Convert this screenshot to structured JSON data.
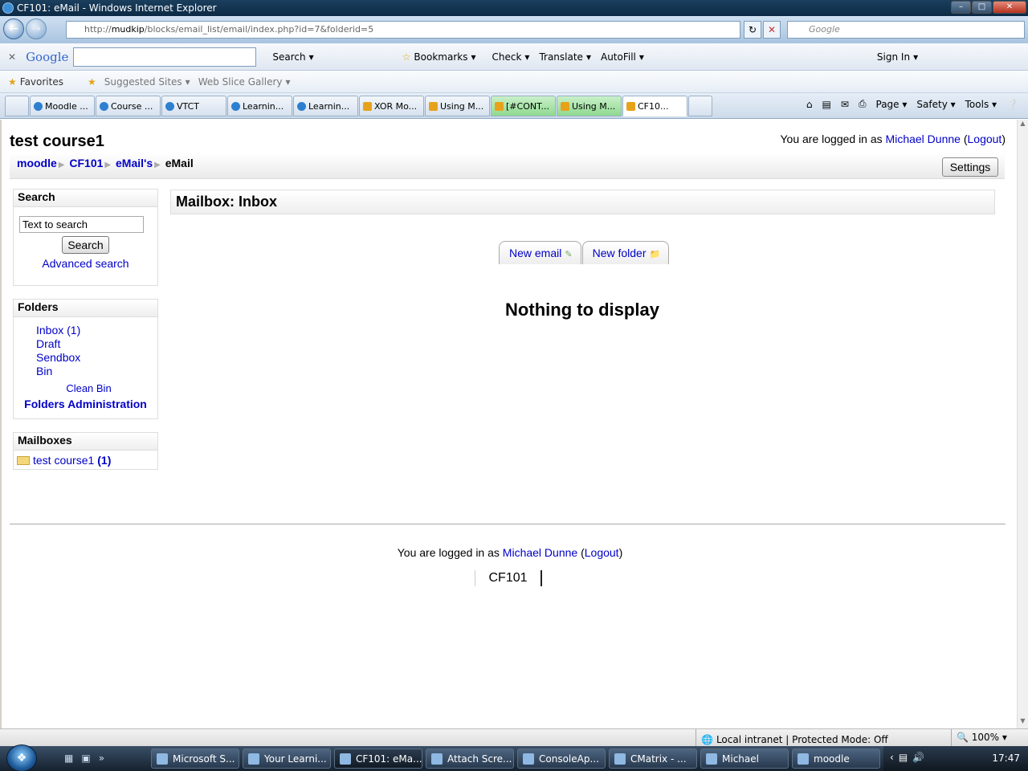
{
  "window": {
    "title": "CF101: eMail - Windows Internet Explorer"
  },
  "address": {
    "prefix": "http://",
    "host": "mudkip",
    "path": "/blocks/email_list/email/index.php?id=7&folderid=5"
  },
  "search_box": {
    "placeholder": "Google"
  },
  "google_toolbar": {
    "logo": "Google",
    "items": [
      "Search",
      "Bookmarks",
      "Check",
      "Translate",
      "AutoFill",
      "Sign In"
    ]
  },
  "favorites_bar": {
    "favorites": "Favorites",
    "items": [
      "Suggested Sites",
      "Web Slice Gallery"
    ]
  },
  "tabs": [
    "Moodle ...",
    "Course ...",
    "VTCT",
    "Learnin...",
    "Learnin...",
    "XOR Mo...",
    "Using M...",
    "[#CONT...",
    "Using M...",
    "CF10..."
  ],
  "command_bar": [
    "Page",
    "Safety",
    "Tools"
  ],
  "page": {
    "course_title": "test course1",
    "login_prefix": "You are logged in as",
    "user": "Michael Dunne",
    "logout": "Logout",
    "breadcrumb": [
      "moodle",
      "CF101",
      "eMail's",
      "eMail"
    ],
    "settings_button": "Settings",
    "search_block": {
      "title": "Search",
      "input_value": "Text to search",
      "button": "Search",
      "advanced": "Advanced search"
    },
    "folders_block": {
      "title": "Folders",
      "items": [
        "Inbox (1)",
        "Draft",
        "Sendbox",
        "Bin"
      ],
      "clean_bin": "Clean Bin",
      "admin": "Folders Administration"
    },
    "mailboxes_block": {
      "title": "Mailboxes",
      "item": "test course1",
      "count": "(1)"
    },
    "main_title": "Mailbox: Inbox",
    "tabs": [
      "New email",
      "New folder"
    ],
    "empty_message": "Nothing to display",
    "footer_link": "CF101"
  },
  "status_bar": {
    "zone": "Local intranet | Protected Mode: Off",
    "zoom": "100%"
  },
  "taskbar": {
    "items": [
      "Microsoft S...",
      "Your Learni...",
      "CF101: eMa...",
      "Attach Scre...",
      "ConsoleAp...",
      "CMatrix - ...",
      "Michael",
      "moodle"
    ],
    "clock": "17:47"
  }
}
